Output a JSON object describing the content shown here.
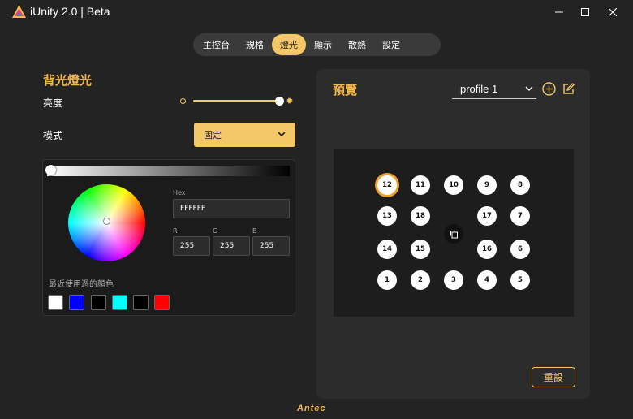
{
  "window": {
    "title": "iUnity 2.0 | Beta",
    "logo_icon": "iunity-logo-icon",
    "controls": [
      "minimize-icon",
      "maximize-icon",
      "close-icon"
    ]
  },
  "tabs": [
    {
      "label": "主控台",
      "active": false
    },
    {
      "label": "規格",
      "active": false
    },
    {
      "label": "燈光",
      "active": true
    },
    {
      "label": "顯示",
      "active": false
    },
    {
      "label": "散熱",
      "active": false
    },
    {
      "label": "設定",
      "active": false
    }
  ],
  "backlight": {
    "title": "背光燈光",
    "brightness_label": "亮度",
    "brightness_level": 1.0,
    "mode_label": "模式",
    "mode_value": "固定",
    "color": {
      "hex_label": "Hex",
      "hex_value": "FFFFFF",
      "r_label": "R",
      "r_value": "255",
      "g_label": "G",
      "g_value": "255",
      "b_label": "B",
      "b_value": "255",
      "recent_label": "最近使用過的顏色",
      "recent_colors": [
        "#ffffff",
        "#0000ff",
        "#000000",
        "#00ffff",
        "#000000",
        "#ff0000"
      ]
    }
  },
  "preview": {
    "title": "預覽",
    "profile_value": "profile 1",
    "fans": [
      "12",
      "11",
      "10",
      "9",
      "8",
      "13",
      "18",
      "17",
      "7",
      "14",
      "15",
      "16",
      "6",
      "1",
      "2",
      "3",
      "4",
      "5"
    ],
    "selected_fan": "12",
    "reset_label": "重設"
  },
  "brand": "Antec",
  "accent_color": "#f5c867"
}
